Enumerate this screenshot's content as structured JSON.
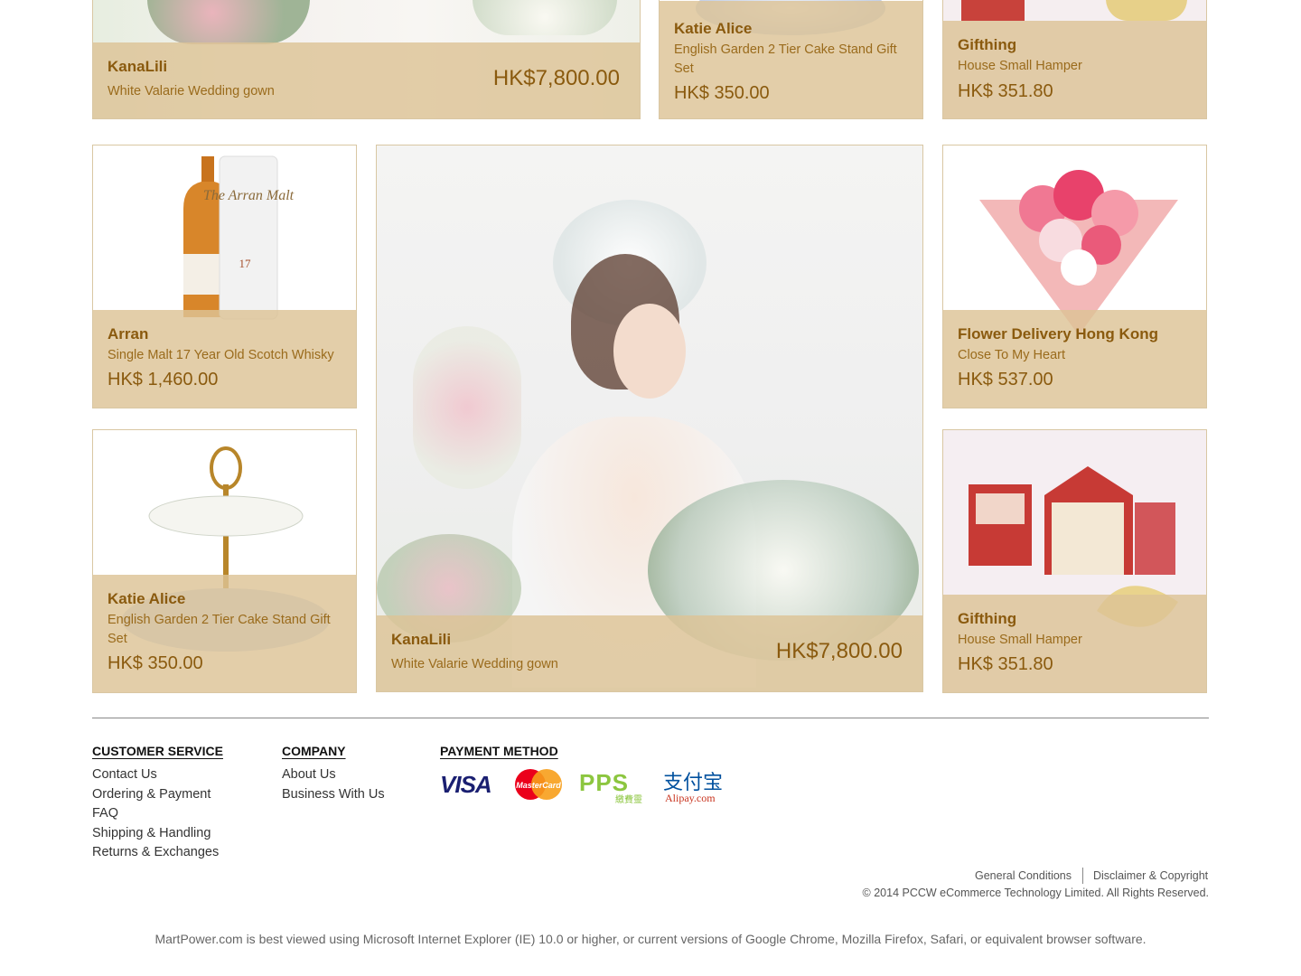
{
  "products": {
    "top_gown": {
      "brand": "KanaLili",
      "desc": "White Valarie Wedding gown",
      "price": "HK$7,800.00"
    },
    "top_cake": {
      "brand": "Katie Alice",
      "desc": "English Garden 2 Tier Cake Stand Gift Set",
      "price": "HK$ 350.00"
    },
    "top_hamper": {
      "brand": "Gifthing",
      "desc": "House Small Hamper",
      "price": "HK$ 351.80"
    },
    "whisky": {
      "brand": "Arran",
      "desc": "Single Malt 17 Year Old Scotch Whisky",
      "price": "HK$ 1,460.00"
    },
    "flower": {
      "brand": "Flower Delivery Hong Kong",
      "desc": "Close To My Heart",
      "price": "HK$ 537.00"
    },
    "cake": {
      "brand": "Katie Alice",
      "desc": "English Garden 2 Tier Cake Stand Gift Set",
      "price": "HK$ 350.00"
    },
    "gown": {
      "brand": "KanaLili",
      "desc": "White Valarie Wedding gown",
      "price": "HK$7,800.00"
    },
    "hamper": {
      "brand": "Gifthing",
      "desc": "House Small Hamper",
      "price": "HK$ 351.80"
    }
  },
  "images": {
    "whisky_bottle_label": "The Arran Malt",
    "whisky_age": "17"
  },
  "footer": {
    "customer_service": {
      "heading": "CUSTOMER SERVICE",
      "links": [
        "Contact Us",
        "Ordering & Payment",
        "FAQ",
        "Shipping & Handling",
        "Returns & Exchanges"
      ]
    },
    "company": {
      "heading": "COMPANY",
      "links": [
        "About Us",
        "Business With Us"
      ]
    },
    "payment": {
      "heading": "PAYMENT METHOD",
      "methods": [
        "VISA",
        "MasterCard",
        "PPS",
        "Alipay.com"
      ],
      "pps_sub": "繳費靈",
      "alipay_cn": "支付宝"
    },
    "general_conditions": "General Conditions",
    "disclaimer": "Disclaimer & Copyright",
    "copyright": "© 2014 PCCW eCommerce Technology Limited. All Rights Reserved.",
    "browser_note": "MartPower.com is best viewed using Microsoft Internet Explorer (IE) 10.0 or higher, or current versions of Google Chrome, Mozilla Firefox, Safari, or equivalent browser software."
  },
  "colors": {
    "overlay": "#ddc396",
    "brand_text": "#8a5a0e",
    "visa": "#1a1f71",
    "mastercard_red": "#eb001b",
    "mastercard_orange": "#f79e1b",
    "pps_green": "#8cc63f",
    "alipay_blue": "#00a0e9"
  }
}
